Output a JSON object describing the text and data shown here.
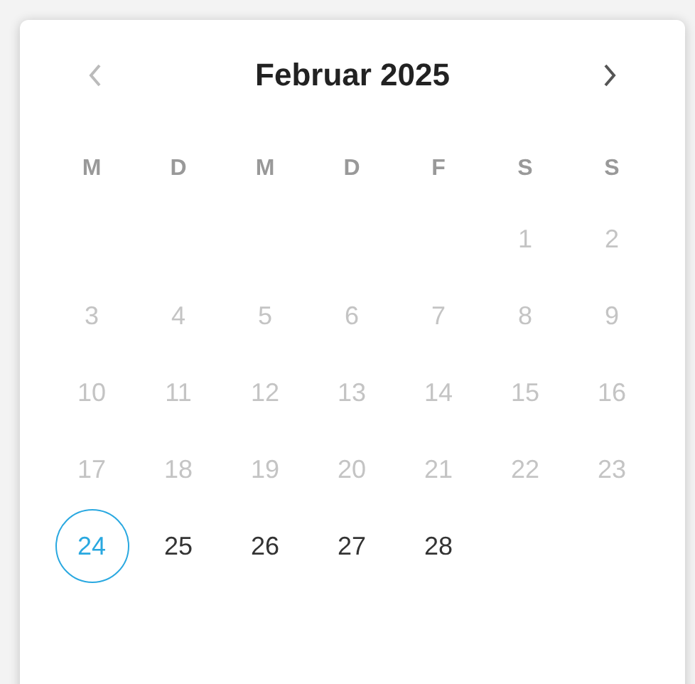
{
  "header": {
    "title": "Februar 2025",
    "prev_disabled": true,
    "next_disabled": false
  },
  "weekdays": [
    "M",
    "D",
    "M",
    "D",
    "F",
    "S",
    "S"
  ],
  "weeks": [
    [
      {
        "kind": "empty"
      },
      {
        "kind": "empty"
      },
      {
        "kind": "empty"
      },
      {
        "kind": "empty"
      },
      {
        "kind": "empty"
      },
      {
        "kind": "day",
        "label": "1",
        "disabled": true,
        "today": false
      },
      {
        "kind": "day",
        "label": "2",
        "disabled": true,
        "today": false
      }
    ],
    [
      {
        "kind": "day",
        "label": "3",
        "disabled": true,
        "today": false
      },
      {
        "kind": "day",
        "label": "4",
        "disabled": true,
        "today": false
      },
      {
        "kind": "day",
        "label": "5",
        "disabled": true,
        "today": false
      },
      {
        "kind": "day",
        "label": "6",
        "disabled": true,
        "today": false
      },
      {
        "kind": "day",
        "label": "7",
        "disabled": true,
        "today": false
      },
      {
        "kind": "day",
        "label": "8",
        "disabled": true,
        "today": false
      },
      {
        "kind": "day",
        "label": "9",
        "disabled": true,
        "today": false
      }
    ],
    [
      {
        "kind": "day",
        "label": "10",
        "disabled": true,
        "today": false
      },
      {
        "kind": "day",
        "label": "11",
        "disabled": true,
        "today": false
      },
      {
        "kind": "day",
        "label": "12",
        "disabled": true,
        "today": false
      },
      {
        "kind": "day",
        "label": "13",
        "disabled": true,
        "today": false
      },
      {
        "kind": "day",
        "label": "14",
        "disabled": true,
        "today": false
      },
      {
        "kind": "day",
        "label": "15",
        "disabled": true,
        "today": false
      },
      {
        "kind": "day",
        "label": "16",
        "disabled": true,
        "today": false
      }
    ],
    [
      {
        "kind": "day",
        "label": "17",
        "disabled": true,
        "today": false
      },
      {
        "kind": "day",
        "label": "18",
        "disabled": true,
        "today": false
      },
      {
        "kind": "day",
        "label": "19",
        "disabled": true,
        "today": false
      },
      {
        "kind": "day",
        "label": "20",
        "disabled": true,
        "today": false
      },
      {
        "kind": "day",
        "label": "21",
        "disabled": true,
        "today": false
      },
      {
        "kind": "day",
        "label": "22",
        "disabled": true,
        "today": false
      },
      {
        "kind": "day",
        "label": "23",
        "disabled": true,
        "today": false
      }
    ],
    [
      {
        "kind": "day",
        "label": "24",
        "disabled": false,
        "today": true
      },
      {
        "kind": "day",
        "label": "25",
        "disabled": false,
        "today": false
      },
      {
        "kind": "day",
        "label": "26",
        "disabled": false,
        "today": false
      },
      {
        "kind": "day",
        "label": "27",
        "disabled": false,
        "today": false
      },
      {
        "kind": "day",
        "label": "28",
        "disabled": false,
        "today": false
      }
    ]
  ]
}
